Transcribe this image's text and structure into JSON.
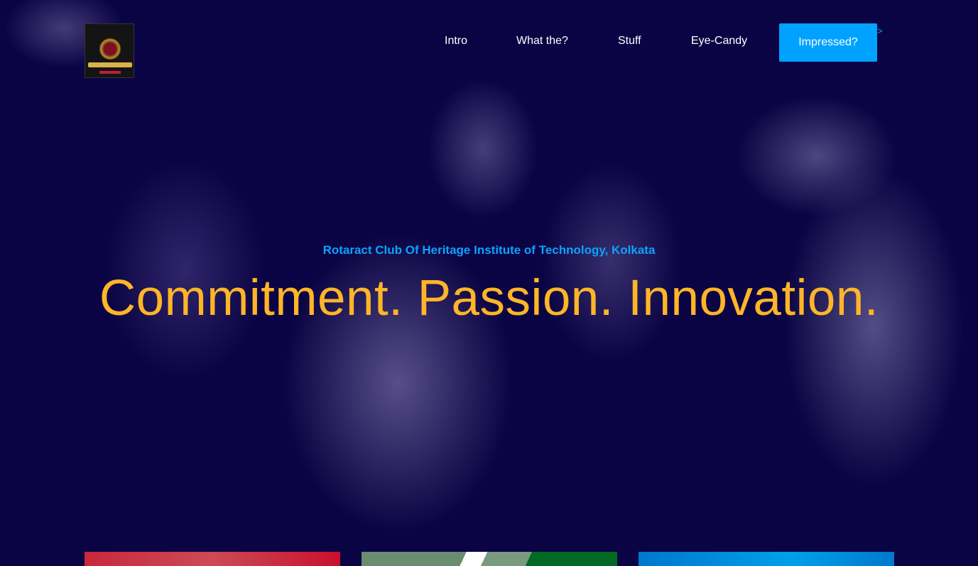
{
  "nav": {
    "items": [
      "Intro",
      "What the?",
      "Stuff",
      "Eye-Candy"
    ],
    "cta_label": "Impressed?",
    "logo_alt": "Rotaract Club of Heritage Institute of Technology logo"
  },
  "hero": {
    "subtitle": "Rotaract Club Of Heritage Institute of Technology, Kolkata",
    "headline": "Commitment. Passion. Innovation."
  },
  "colors": {
    "background": "#0b0444",
    "accent_blue": "#00a2ff",
    "headline_yellow": "#ffb527",
    "card_red": "#c8283c",
    "card_green": "#006a25",
    "card_blue": "#0078cc"
  }
}
